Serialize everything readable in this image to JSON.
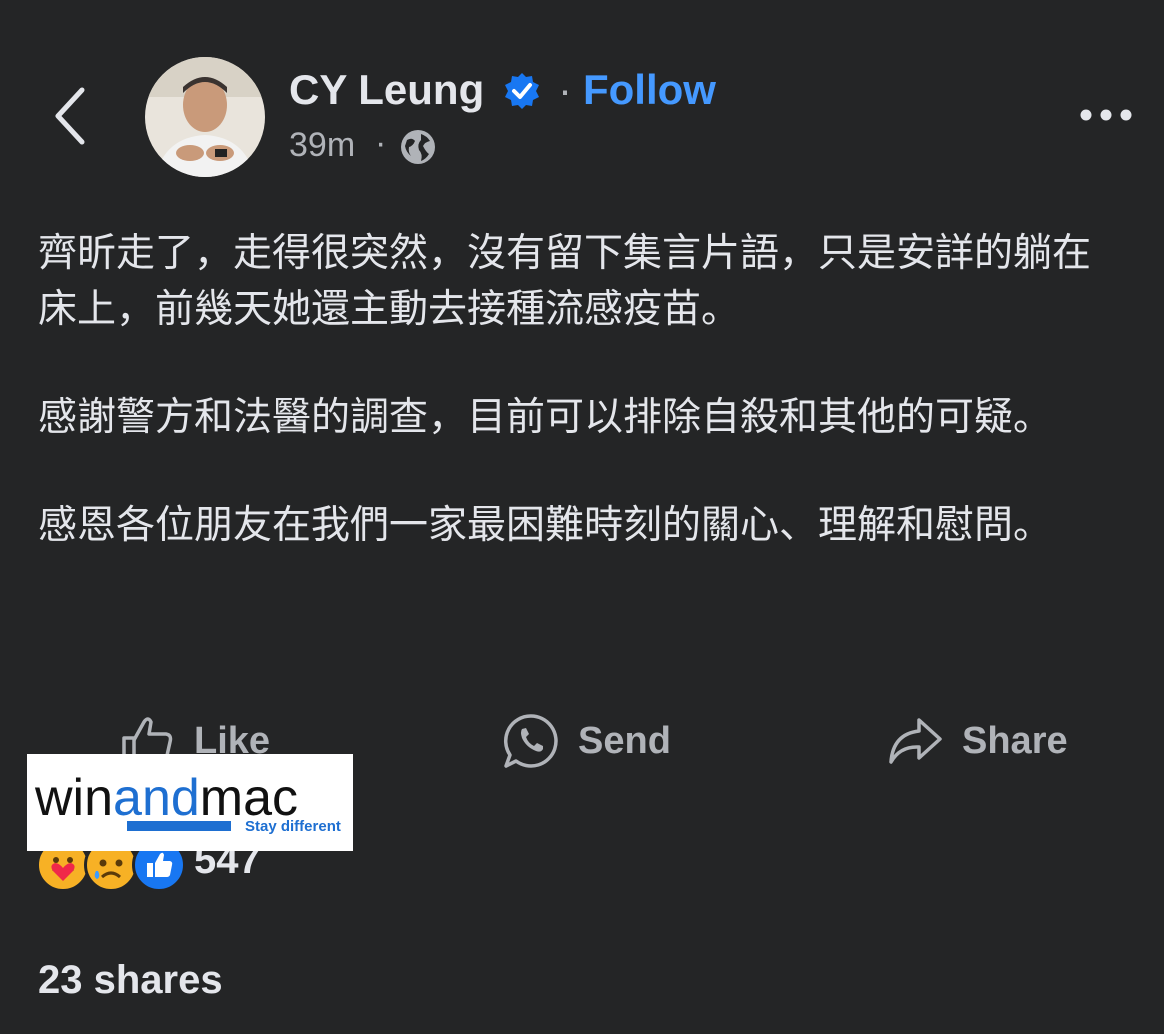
{
  "header": {
    "author_name": "CY Leung",
    "separator": "·",
    "follow_label": "Follow",
    "time": "39m",
    "time_separator": "·",
    "audience_icon": "globe-icon"
  },
  "post": {
    "paragraphs": [
      "齊昕走了，走得很突然，沒有留下集言片語，只是安詳的躺在床上，前幾天她還主動去接種流感疫苗。",
      "感謝警方和法醫的調查，目前可以排除自殺和其他的可疑。",
      "感恩各位朋友在我們一家最困難時刻的關心、理解和慰問。"
    ]
  },
  "actions": {
    "like_label": "Like",
    "send_label": "Send",
    "share_label": "Share"
  },
  "watermark": {
    "brand_part1": "win",
    "brand_part2": "and",
    "brand_part3": "mac",
    "tagline": "Stay different"
  },
  "stats": {
    "reaction_count": "547",
    "shares": "23 shares"
  },
  "colors": {
    "background": "#242526",
    "text": "#e4e6eb",
    "secondary": "#b0b3b8",
    "follow": "#4599ff",
    "verified": "#1877f2"
  }
}
